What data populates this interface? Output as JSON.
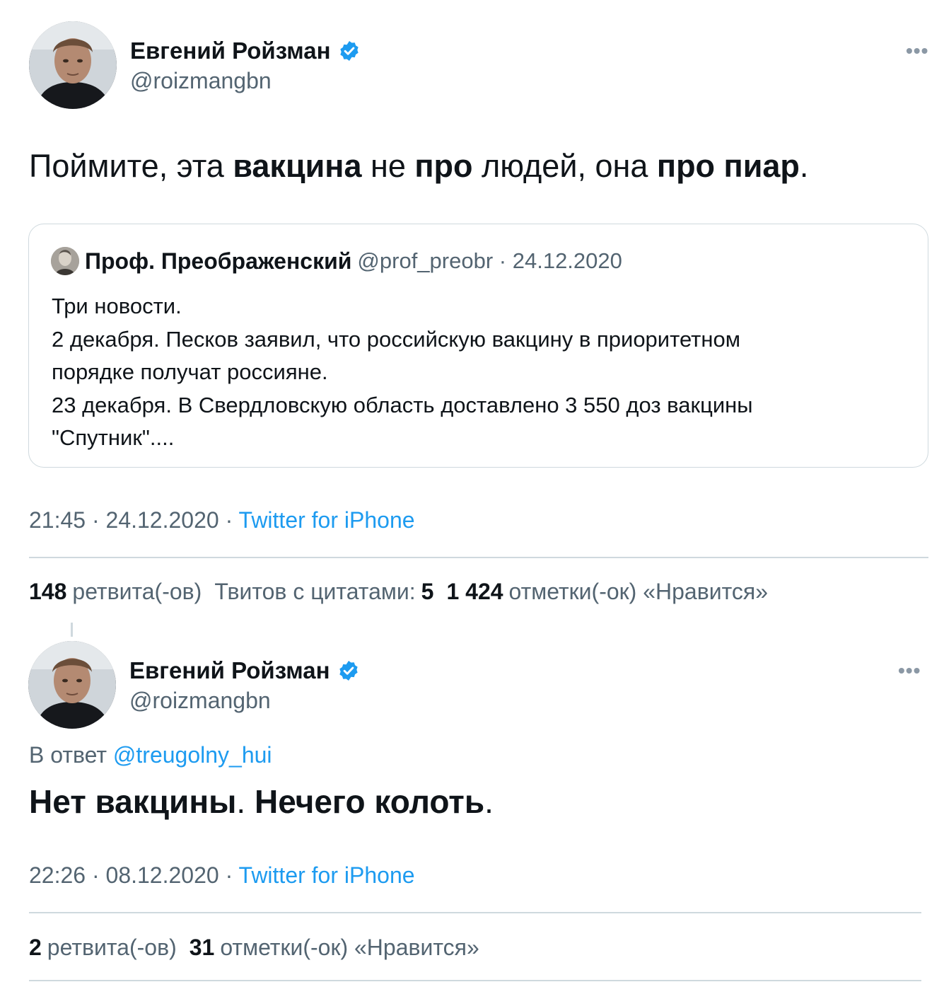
{
  "tweet1": {
    "author_name": "Евгений Ройзман",
    "author_handle": "@roizmangbn",
    "more_label": "•••",
    "text_parts": [
      "Поймите, эта ",
      "вакцина",
      " не ",
      "про",
      " людей, она ",
      "про пиар",
      "."
    ],
    "quote": {
      "name": "Проф. Преображенский",
      "handle": "@prof_preobr",
      "separator": " · ",
      "date": "24.12.2020",
      "lines": [
        "Три новости.",
        "2 декабря. Песков заявил, что российскую вакцину в приоритетном",
        "порядке получат россияне.",
        "23 декабря. В Свердловскую область доставлено 3 550 доз вакцины",
        "\"Спутник\"...."
      ]
    },
    "time": "21:45",
    "date": "24.12.2020",
    "separator": " · ",
    "source": "Twitter for iPhone",
    "stats": {
      "retweets_count": "148",
      "retweets_label": "ретвита(-ов)",
      "quotes_label": "Твитов с цитатами:",
      "quotes_count": "5",
      "likes_count": "1 424",
      "likes_label": "отметки(-ок) «Нравится»"
    }
  },
  "tweet2": {
    "author_name": "Евгений Ройзман",
    "author_handle": "@roizmangbn",
    "more_label": "•••",
    "reply_prefix": "В ответ ",
    "reply_handle": "@treugolny_hui",
    "text_parts": [
      "Нет вакцины",
      ". ",
      "Нечего колоть",
      "."
    ],
    "time": "22:26",
    "date": "08.12.2020",
    "separator": " · ",
    "source": "Twitter for iPhone",
    "stats": {
      "retweets_count": "2",
      "retweets_label": "ретвита(-ов)",
      "likes_count": "31",
      "likes_label": "отметки(-ок) «Нравится»"
    }
  },
  "colors": {
    "text": "#0f1419",
    "secondary": "#536471",
    "link": "#1d9bf0",
    "border": "#cfd9de",
    "verified": "#1d9bf0"
  },
  "icons": {
    "verified": "verified-badge-icon",
    "more": "more-options-icon"
  }
}
